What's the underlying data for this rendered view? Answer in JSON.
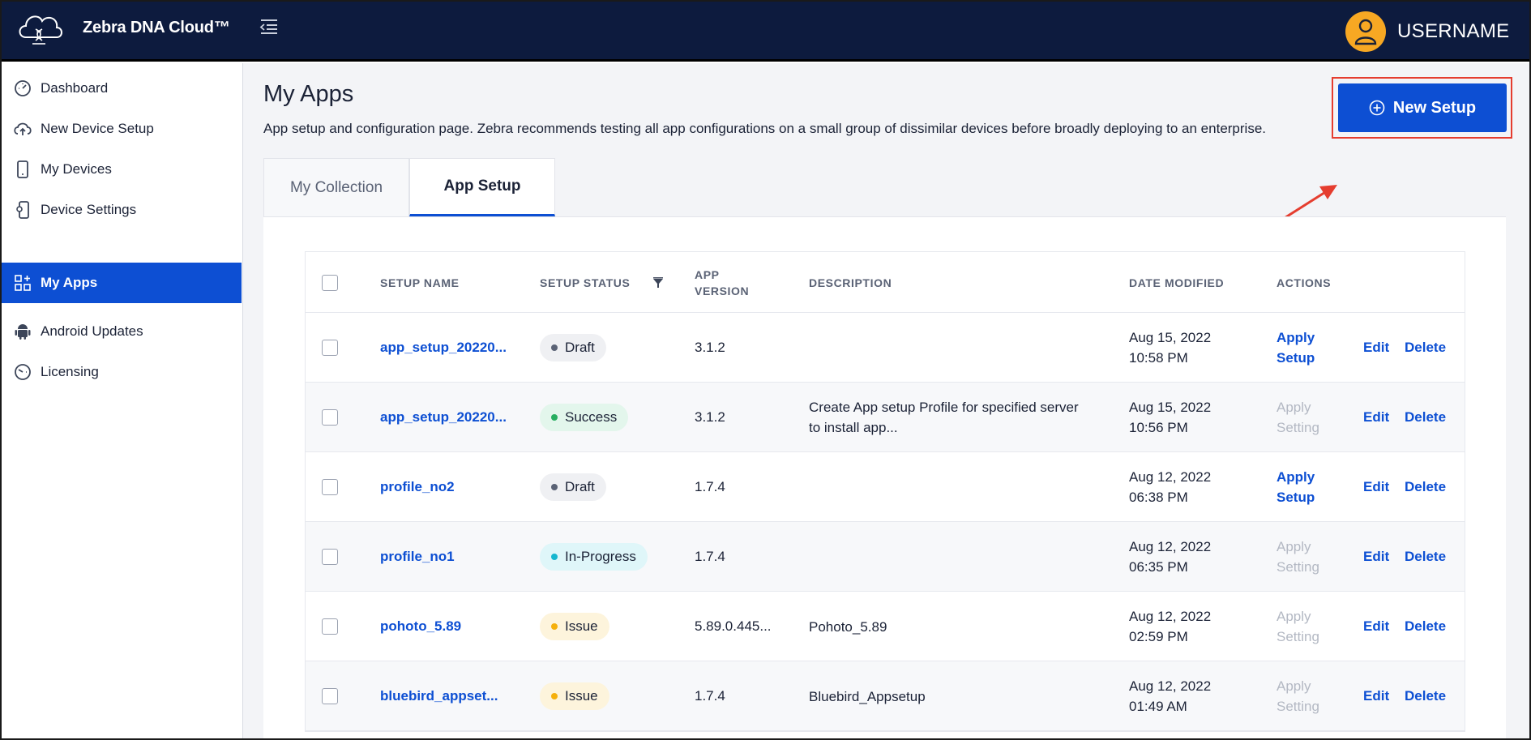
{
  "header": {
    "app_title": "Zebra DNA Cloud™",
    "username": "USERNAME"
  },
  "sidebar": {
    "items": [
      {
        "label": "Dashboard",
        "icon": "dashboard-gauge-icon"
      },
      {
        "label": "New Device Setup",
        "icon": "cloud-upload-icon"
      },
      {
        "label": "My Devices",
        "icon": "mobile-device-icon"
      },
      {
        "label": "Device Settings",
        "icon": "device-settings-icon"
      },
      {
        "label": "My Apps",
        "icon": "apps-grid-icon",
        "active": true
      },
      {
        "label": "Android Updates",
        "icon": "android-icon"
      },
      {
        "label": "Licensing",
        "icon": "licensing-gauge-icon"
      }
    ]
  },
  "main": {
    "title": "My Apps",
    "description": "App setup and configuration page. Zebra recommends testing all app configurations on a small group of dissimilar devices before broadly deploying to an enterprise.",
    "new_setup_label": "New Setup",
    "tabs": [
      {
        "label": "My Collection",
        "active": false
      },
      {
        "label": "App Setup",
        "active": true
      }
    ]
  },
  "table": {
    "columns": {
      "setup_name": "SETUP NAME",
      "setup_status": "SETUP STATUS",
      "app_version_line1": "APP",
      "app_version_line2": "VERSION",
      "description": "DESCRIPTION",
      "date_modified": "DATE MODIFIED",
      "actions": "ACTIONS"
    },
    "rows": [
      {
        "name": "app_setup_20220...",
        "status": "Draft",
        "status_kind": "draft",
        "version": "3.1.2",
        "description_line1": "",
        "description_line2": "",
        "date": "Aug 15, 2022",
        "time": "10:58 PM",
        "apply_line1": "Apply",
        "apply_line2": "Setup",
        "apply_enabled": true,
        "edit": "Edit",
        "delete": "Delete"
      },
      {
        "name": "app_setup_20220...",
        "status": "Success",
        "status_kind": "success",
        "version": "3.1.2",
        "description_line1": "Create App setup Profile for specified server",
        "description_line2": "to install app...",
        "date": "Aug 15, 2022",
        "time": "10:56 PM",
        "apply_line1": "Apply",
        "apply_line2": "Setting",
        "apply_enabled": false,
        "edit": "Edit",
        "delete": "Delete"
      },
      {
        "name": "profile_no2",
        "status": "Draft",
        "status_kind": "draft",
        "version": "1.7.4",
        "description_line1": "",
        "description_line2": "",
        "date": "Aug 12, 2022",
        "time": "06:38 PM",
        "apply_line1": "Apply",
        "apply_line2": "Setup",
        "apply_enabled": true,
        "edit": "Edit",
        "delete": "Delete"
      },
      {
        "name": "profile_no1",
        "status": "In-Progress",
        "status_kind": "progress",
        "version": "1.7.4",
        "description_line1": "",
        "description_line2": "",
        "date": "Aug 12, 2022",
        "time": "06:35 PM",
        "apply_line1": "Apply",
        "apply_line2": "Setting",
        "apply_enabled": false,
        "edit": "Edit",
        "delete": "Delete"
      },
      {
        "name": "pohoto_5.89",
        "status": "Issue",
        "status_kind": "issue",
        "version": "5.89.0.445...",
        "description_line1": "Pohoto_5.89",
        "description_line2": "",
        "date": "Aug 12, 2022",
        "time": "02:59 PM",
        "apply_line1": "Apply",
        "apply_line2": "Setting",
        "apply_enabled": false,
        "edit": "Edit",
        "delete": "Delete"
      },
      {
        "name": "bluebird_appset...",
        "status": "Issue",
        "status_kind": "issue",
        "version": "1.7.4",
        "description_line1": "Bluebird_Appsetup",
        "description_line2": "",
        "date": "Aug 12, 2022",
        "time": "01:49 AM",
        "apply_line1": "Apply",
        "apply_line2": "Setting",
        "apply_enabled": false,
        "edit": "Edit",
        "delete": "Delete"
      }
    ]
  },
  "colors": {
    "header_bg": "#0d1b3e",
    "accent_blue": "#0d4fd3",
    "avatar_orange": "#f7a823",
    "highlight_red": "#e53d2f"
  }
}
